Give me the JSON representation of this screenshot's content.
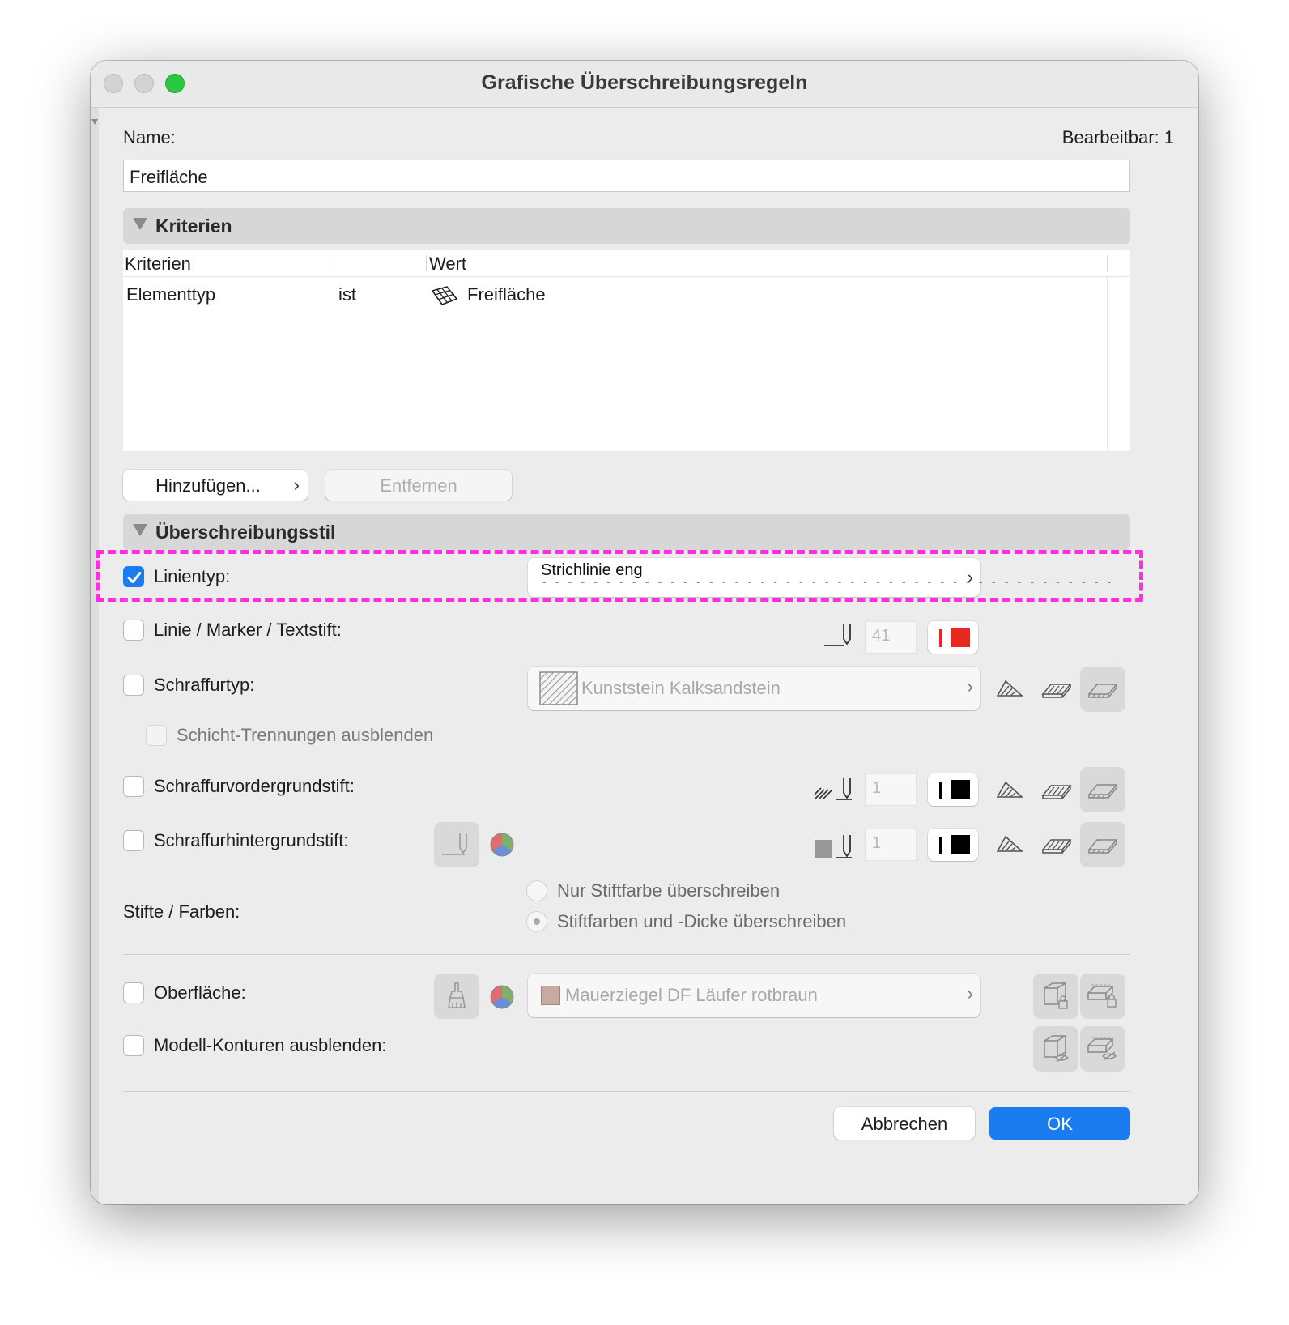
{
  "window": {
    "title": "Grafische Überschreibungsregeln"
  },
  "name": {
    "label": "Name:",
    "editable_label": "Bearbeitbar: 1",
    "value": "Freifläche"
  },
  "kriterien": {
    "section_title": "Kriterien",
    "columns": [
      "Kriterien",
      "",
      "Wert"
    ],
    "rows": [
      {
        "criterion": "Elementtyp",
        "operator": "ist",
        "value": "Freifläche"
      }
    ],
    "add_button": "Hinzufügen...",
    "remove_button": "Entfernen"
  },
  "style": {
    "section_title": "Überschreibungsstil",
    "linientyp": {
      "label": "Linientyp:",
      "checked": true,
      "value": "Strichlinie eng",
      "dashes": "- - - - - - - - - - - - - - - - - - - - - - - - - - - - - - - - - - - - - - - - - - - - -"
    },
    "linie_marker": {
      "label": "Linie / Marker / Textstift:",
      "pen": "41",
      "color": "#e8281e"
    },
    "schraffurtyp": {
      "label": "Schraffurtyp:",
      "value": "Kunststein Kalksandstein"
    },
    "schicht": {
      "label": "Schicht-Trennungen ausblenden"
    },
    "vordergrund": {
      "label": "Schraffurvordergrundstift:",
      "pen": "1",
      "color": "#000000"
    },
    "hintergrund": {
      "label": "Schraffurhintergrundstift:",
      "pen": "1",
      "color": "#000000"
    },
    "stifte": {
      "label": "Stifte / Farben:",
      "options": [
        "Nur Stiftfarbe überschreiben",
        "Stiftfarben und -Dicke überschreiben"
      ],
      "selected": 1
    },
    "oberflaeche": {
      "label": "Oberfläche:",
      "value": "Mauerziegel DF Läufer rotbraun",
      "swatch": "#c9aaa2"
    },
    "modell": {
      "label": "Modell-Konturen ausblenden:"
    }
  },
  "footer": {
    "cancel": "Abbrechen",
    "ok": "OK"
  },
  "colors": {
    "accent": "#1b7cf0",
    "highlight": "#ff2fe0",
    "close": "#d0d0d0",
    "min": "#d0d0d0",
    "zoom": "#2ac840"
  }
}
